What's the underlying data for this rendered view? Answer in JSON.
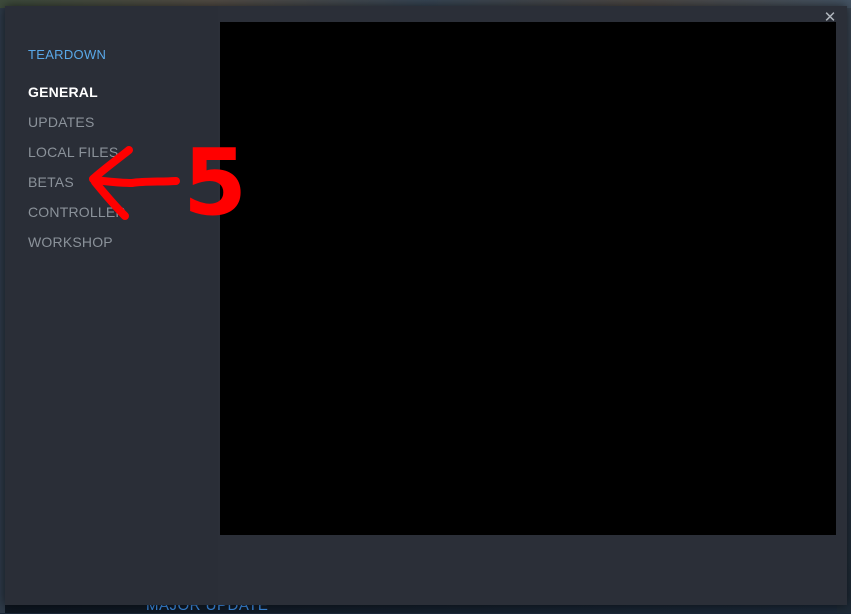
{
  "dialog": {
    "title": "TEARDOWN",
    "close_glyph": "✕",
    "menu": [
      {
        "label": "GENERAL",
        "active": true
      },
      {
        "label": "UPDATES",
        "active": false
      },
      {
        "label": "LOCAL FILES",
        "active": false
      },
      {
        "label": "BETAS",
        "active": false
      },
      {
        "label": "CONTROLLER",
        "active": false
      },
      {
        "label": "WORKSHOP",
        "active": false
      }
    ]
  },
  "background": {
    "bottom_text": "MAJOR UPDATE"
  },
  "annotation": {
    "label": "5",
    "color": "#ff0000"
  },
  "colors": {
    "accent": "#59a8e8",
    "sidebar_bg": "#2a2e37",
    "content_bg": "#2b2f38",
    "active_text": "#ffffff",
    "inactive_text": "#8b929a"
  }
}
